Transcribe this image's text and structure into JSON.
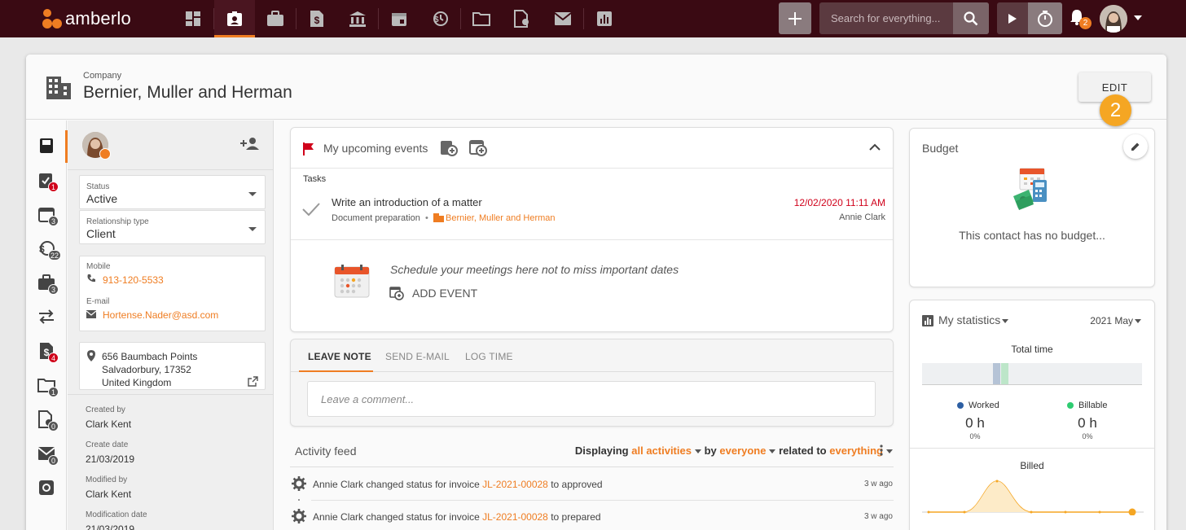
{
  "brand": {
    "name": "amberlo",
    "accent": "#ef7d22",
    "topbar_bg": "#3a0a13"
  },
  "nav": {
    "icons": [
      "dashboard-icon",
      "contacts-icon",
      "matters-icon",
      "invoices-icon",
      "bank-icon",
      "calendar-icon",
      "time-icon",
      "folder-icon",
      "documents-icon",
      "mail-icon",
      "reports-icon"
    ],
    "active": "contacts-icon"
  },
  "search": {
    "placeholder": "Search for everything..."
  },
  "notifications": {
    "count": "2"
  },
  "header": {
    "type": "Company",
    "title": "Bernier, Muller and Herman",
    "edit_label": "EDIT",
    "step_badge": "2"
  },
  "rail": [
    {
      "icon": "book-icon",
      "badge": ""
    },
    {
      "icon": "tasks-icon",
      "badge": "1",
      "red": true
    },
    {
      "icon": "calendar-icon",
      "badge": "3"
    },
    {
      "icon": "time-entries-icon",
      "badge": "22"
    },
    {
      "icon": "briefcase-icon",
      "badge": "3"
    },
    {
      "icon": "transfer-icon",
      "badge": ""
    },
    {
      "icon": "invoice-icon",
      "badge": "4",
      "red": true
    },
    {
      "icon": "folder-icon",
      "badge": "1"
    },
    {
      "icon": "document-settings-icon",
      "badge": "0"
    },
    {
      "icon": "mail-icon",
      "badge": "0"
    },
    {
      "icon": "settings-icon",
      "badge": ""
    }
  ],
  "profile": {
    "status_label": "Status",
    "status_value": "Active",
    "relationship_label": "Relationship type",
    "relationship_value": "Client",
    "mobile_label": "Mobile",
    "mobile_value": "913-120-5533",
    "email_label": "E-mail",
    "email_value": "Hortense.Nader@asd.com",
    "address_line1": "656 Baumbach Points",
    "address_line2": "Salvadorbury, 17352",
    "address_line3": "United Kingdom",
    "created_by_label": "Created by",
    "created_by_value": "Clark Kent",
    "create_date_label": "Create date",
    "create_date_value": "21/03/2019",
    "modified_by_label": "Modified by",
    "modified_by_value": "Clark Kent",
    "modification_date_label": "Modification date",
    "modification_date_value": "21/03/2019"
  },
  "events": {
    "title": "My upcoming events",
    "tasks_label": "Tasks",
    "task": {
      "title": "Write an introduction of a matter",
      "category": "Document preparation",
      "company": "Bernier, Muller and Herman",
      "date": "12/02/2020 11:11 AM",
      "assignee": "Annie Clark"
    },
    "empty_text": "Schedule your meetings here not to miss important dates",
    "add_event_label": "ADD EVENT"
  },
  "note": {
    "tabs": [
      "LEAVE NOTE",
      "SEND E-MAIL",
      "LOG TIME"
    ],
    "placeholder": "Leave a comment..."
  },
  "feed": {
    "title": "Activity feed",
    "displaying": "Displaying",
    "filter_activities": "all activities",
    "by": "by",
    "filter_user": "everyone",
    "related_to": "related to",
    "filter_related": "everything",
    "rows": [
      {
        "text": "Annie Clark changed status for invoice",
        "invoice": "JL-2021-00028",
        "suffix": "to approved",
        "ago": "3 w ago"
      },
      {
        "text": "Annie Clark changed status for invoice",
        "invoice": "JL-2021-00028",
        "suffix": "to prepared",
        "ago": "3 w ago"
      }
    ]
  },
  "budget": {
    "title": "Budget",
    "empty_text": "This contact has no budget..."
  },
  "stats": {
    "title": "My statistics",
    "period": "2021 May",
    "total_time_label": "Total time",
    "worked_label": "Worked",
    "worked_value": "0 h",
    "worked_pct": "0%",
    "billable_label": "Billable",
    "billable_value": "0 h",
    "billable_pct": "0%",
    "billed_label": "Billed",
    "worked_color": "#2d5fa3",
    "billable_color": "#2ecc71",
    "billed_color": "#f5a623"
  }
}
